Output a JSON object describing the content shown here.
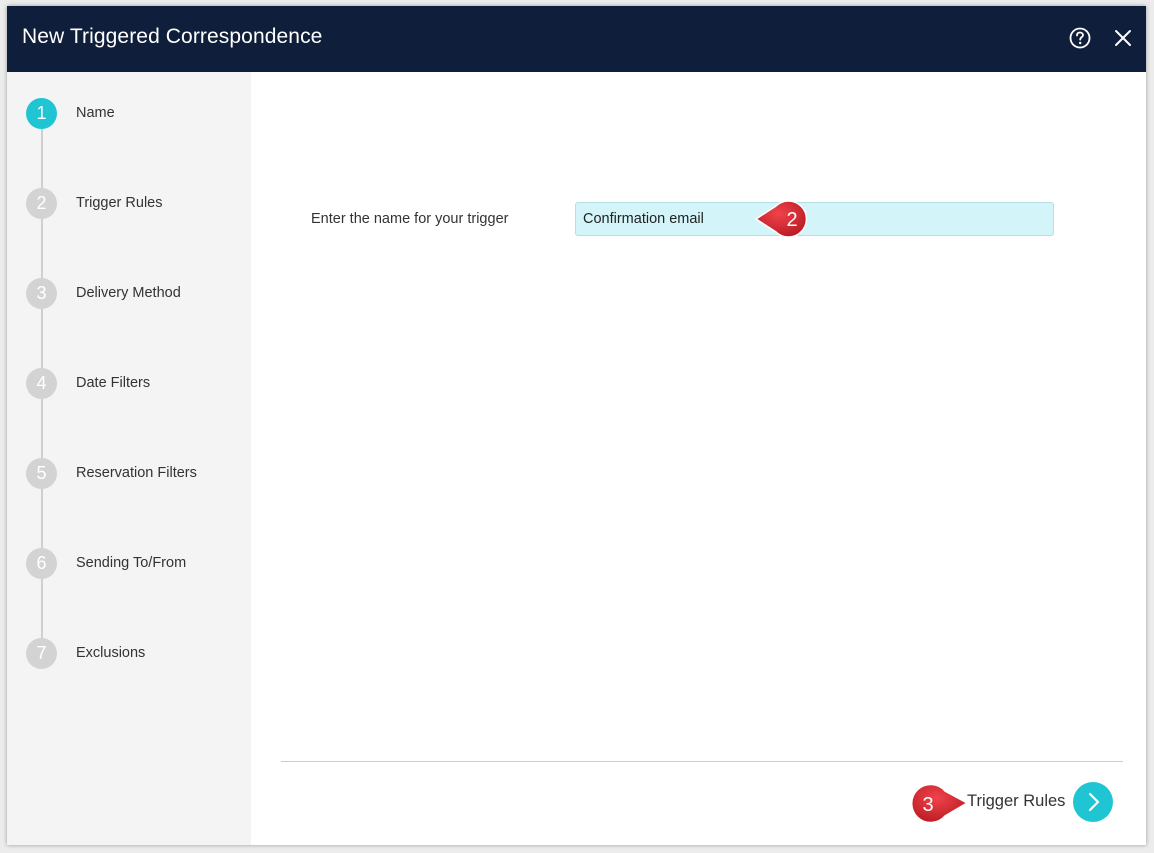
{
  "dialog": {
    "title": "New Triggered Correspondence",
    "help_icon": "help-circle-icon",
    "close_icon": "close-icon"
  },
  "steps": [
    {
      "number": "1",
      "label": "Name",
      "active": true
    },
    {
      "number": "2",
      "label": "Trigger Rules",
      "active": false
    },
    {
      "number": "3",
      "label": "Delivery Method",
      "active": false
    },
    {
      "number": "4",
      "label": "Date Filters",
      "active": false
    },
    {
      "number": "5",
      "label": "Reservation Filters",
      "active": false
    },
    {
      "number": "6",
      "label": "Sending To/From",
      "active": false
    },
    {
      "number": "7",
      "label": "Exclusions",
      "active": false
    }
  ],
  "form": {
    "name_label": "Enter the name for your trigger",
    "name_value": "Confirmation email"
  },
  "footer": {
    "next_label": "Trigger Rules",
    "next_icon": "chevron-right-icon"
  },
  "annotations": [
    {
      "number": "2"
    },
    {
      "number": "3"
    }
  ],
  "colors": {
    "header_bg": "#0f1e3a",
    "accent": "#20c5d4",
    "input_bg": "#d3f5f9",
    "callout": "#d9252f",
    "sidebar_bg": "#f4f4f4"
  }
}
